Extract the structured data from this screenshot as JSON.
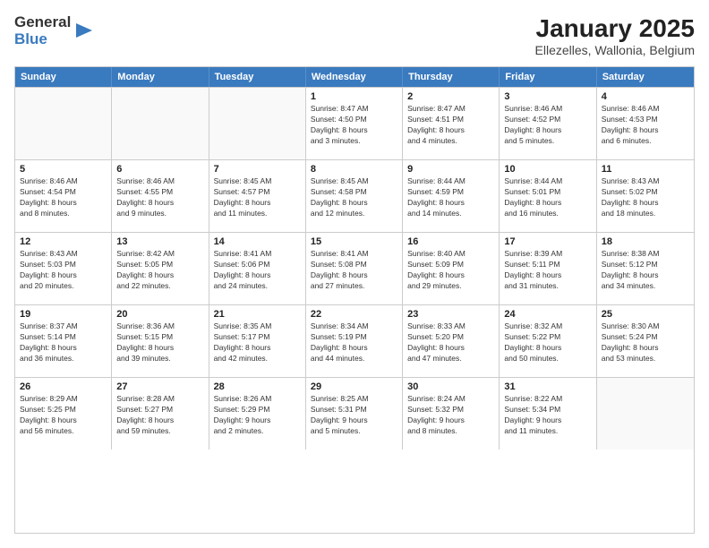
{
  "logo": {
    "general": "General",
    "blue": "Blue"
  },
  "title": "January 2025",
  "subtitle": "Ellezelles, Wallonia, Belgium",
  "days": [
    "Sunday",
    "Monday",
    "Tuesday",
    "Wednesday",
    "Thursday",
    "Friday",
    "Saturday"
  ],
  "rows": [
    [
      {
        "num": "",
        "lines": []
      },
      {
        "num": "",
        "lines": []
      },
      {
        "num": "",
        "lines": []
      },
      {
        "num": "1",
        "lines": [
          "Sunrise: 8:47 AM",
          "Sunset: 4:50 PM",
          "Daylight: 8 hours",
          "and 3 minutes."
        ]
      },
      {
        "num": "2",
        "lines": [
          "Sunrise: 8:47 AM",
          "Sunset: 4:51 PM",
          "Daylight: 8 hours",
          "and 4 minutes."
        ]
      },
      {
        "num": "3",
        "lines": [
          "Sunrise: 8:46 AM",
          "Sunset: 4:52 PM",
          "Daylight: 8 hours",
          "and 5 minutes."
        ]
      },
      {
        "num": "4",
        "lines": [
          "Sunrise: 8:46 AM",
          "Sunset: 4:53 PM",
          "Daylight: 8 hours",
          "and 6 minutes."
        ]
      }
    ],
    [
      {
        "num": "5",
        "lines": [
          "Sunrise: 8:46 AM",
          "Sunset: 4:54 PM",
          "Daylight: 8 hours",
          "and 8 minutes."
        ]
      },
      {
        "num": "6",
        "lines": [
          "Sunrise: 8:46 AM",
          "Sunset: 4:55 PM",
          "Daylight: 8 hours",
          "and 9 minutes."
        ]
      },
      {
        "num": "7",
        "lines": [
          "Sunrise: 8:45 AM",
          "Sunset: 4:57 PM",
          "Daylight: 8 hours",
          "and 11 minutes."
        ]
      },
      {
        "num": "8",
        "lines": [
          "Sunrise: 8:45 AM",
          "Sunset: 4:58 PM",
          "Daylight: 8 hours",
          "and 12 minutes."
        ]
      },
      {
        "num": "9",
        "lines": [
          "Sunrise: 8:44 AM",
          "Sunset: 4:59 PM",
          "Daylight: 8 hours",
          "and 14 minutes."
        ]
      },
      {
        "num": "10",
        "lines": [
          "Sunrise: 8:44 AM",
          "Sunset: 5:01 PM",
          "Daylight: 8 hours",
          "and 16 minutes."
        ]
      },
      {
        "num": "11",
        "lines": [
          "Sunrise: 8:43 AM",
          "Sunset: 5:02 PM",
          "Daylight: 8 hours",
          "and 18 minutes."
        ]
      }
    ],
    [
      {
        "num": "12",
        "lines": [
          "Sunrise: 8:43 AM",
          "Sunset: 5:03 PM",
          "Daylight: 8 hours",
          "and 20 minutes."
        ]
      },
      {
        "num": "13",
        "lines": [
          "Sunrise: 8:42 AM",
          "Sunset: 5:05 PM",
          "Daylight: 8 hours",
          "and 22 minutes."
        ]
      },
      {
        "num": "14",
        "lines": [
          "Sunrise: 8:41 AM",
          "Sunset: 5:06 PM",
          "Daylight: 8 hours",
          "and 24 minutes."
        ]
      },
      {
        "num": "15",
        "lines": [
          "Sunrise: 8:41 AM",
          "Sunset: 5:08 PM",
          "Daylight: 8 hours",
          "and 27 minutes."
        ]
      },
      {
        "num": "16",
        "lines": [
          "Sunrise: 8:40 AM",
          "Sunset: 5:09 PM",
          "Daylight: 8 hours",
          "and 29 minutes."
        ]
      },
      {
        "num": "17",
        "lines": [
          "Sunrise: 8:39 AM",
          "Sunset: 5:11 PM",
          "Daylight: 8 hours",
          "and 31 minutes."
        ]
      },
      {
        "num": "18",
        "lines": [
          "Sunrise: 8:38 AM",
          "Sunset: 5:12 PM",
          "Daylight: 8 hours",
          "and 34 minutes."
        ]
      }
    ],
    [
      {
        "num": "19",
        "lines": [
          "Sunrise: 8:37 AM",
          "Sunset: 5:14 PM",
          "Daylight: 8 hours",
          "and 36 minutes."
        ]
      },
      {
        "num": "20",
        "lines": [
          "Sunrise: 8:36 AM",
          "Sunset: 5:15 PM",
          "Daylight: 8 hours",
          "and 39 minutes."
        ]
      },
      {
        "num": "21",
        "lines": [
          "Sunrise: 8:35 AM",
          "Sunset: 5:17 PM",
          "Daylight: 8 hours",
          "and 42 minutes."
        ]
      },
      {
        "num": "22",
        "lines": [
          "Sunrise: 8:34 AM",
          "Sunset: 5:19 PM",
          "Daylight: 8 hours",
          "and 44 minutes."
        ]
      },
      {
        "num": "23",
        "lines": [
          "Sunrise: 8:33 AM",
          "Sunset: 5:20 PM",
          "Daylight: 8 hours",
          "and 47 minutes."
        ]
      },
      {
        "num": "24",
        "lines": [
          "Sunrise: 8:32 AM",
          "Sunset: 5:22 PM",
          "Daylight: 8 hours",
          "and 50 minutes."
        ]
      },
      {
        "num": "25",
        "lines": [
          "Sunrise: 8:30 AM",
          "Sunset: 5:24 PM",
          "Daylight: 8 hours",
          "and 53 minutes."
        ]
      }
    ],
    [
      {
        "num": "26",
        "lines": [
          "Sunrise: 8:29 AM",
          "Sunset: 5:25 PM",
          "Daylight: 8 hours",
          "and 56 minutes."
        ]
      },
      {
        "num": "27",
        "lines": [
          "Sunrise: 8:28 AM",
          "Sunset: 5:27 PM",
          "Daylight: 8 hours",
          "and 59 minutes."
        ]
      },
      {
        "num": "28",
        "lines": [
          "Sunrise: 8:26 AM",
          "Sunset: 5:29 PM",
          "Daylight: 9 hours",
          "and 2 minutes."
        ]
      },
      {
        "num": "29",
        "lines": [
          "Sunrise: 8:25 AM",
          "Sunset: 5:31 PM",
          "Daylight: 9 hours",
          "and 5 minutes."
        ]
      },
      {
        "num": "30",
        "lines": [
          "Sunrise: 8:24 AM",
          "Sunset: 5:32 PM",
          "Daylight: 9 hours",
          "and 8 minutes."
        ]
      },
      {
        "num": "31",
        "lines": [
          "Sunrise: 8:22 AM",
          "Sunset: 5:34 PM",
          "Daylight: 9 hours",
          "and 11 minutes."
        ]
      },
      {
        "num": "",
        "lines": []
      }
    ]
  ]
}
